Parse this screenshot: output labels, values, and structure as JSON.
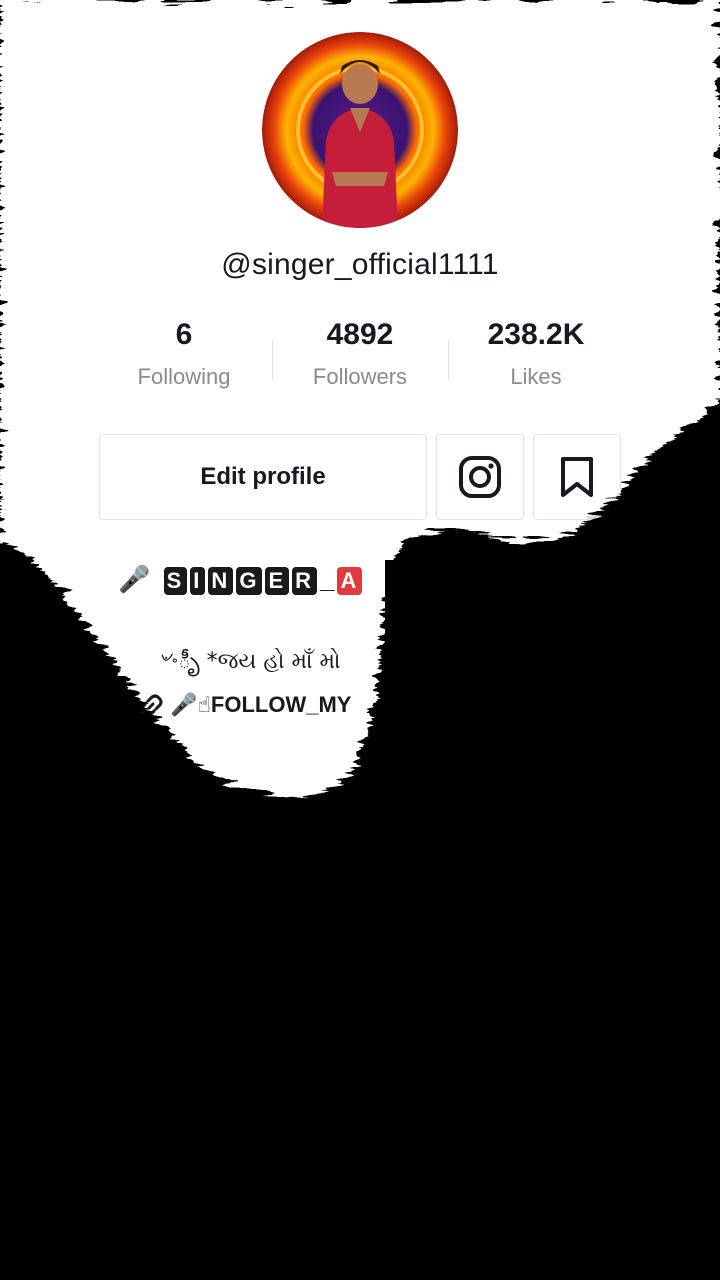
{
  "profile": {
    "username": "@singer_official1111"
  },
  "stats": [
    {
      "value": "6",
      "label": "Following"
    },
    {
      "value": "4892",
      "label": "Followers"
    },
    {
      "value": "238.2K",
      "label": "Likes"
    }
  ],
  "actions": {
    "edit_profile_label": "Edit profile",
    "instagram_icon": "instagram-icon",
    "bookmark_icon": "bookmark-icon"
  },
  "bio": {
    "line1_prefix": "🎤",
    "line1_letters": [
      "S",
      "I",
      "N",
      "G",
      "E",
      "R"
    ],
    "line1_separator": "_",
    "line1_partial": "A",
    "line2": "৺৽ీృ *જય હો માઁ મો",
    "line3_prefix": "🎤☝",
    "line3_text": "FOLLOW_MY"
  },
  "colors": {
    "text_primary": "#161823",
    "text_secondary": "#8a8b91",
    "border": "#e3e3e4",
    "tile_dark": "#1a1a1a",
    "tile_red": "#e03a3a"
  }
}
